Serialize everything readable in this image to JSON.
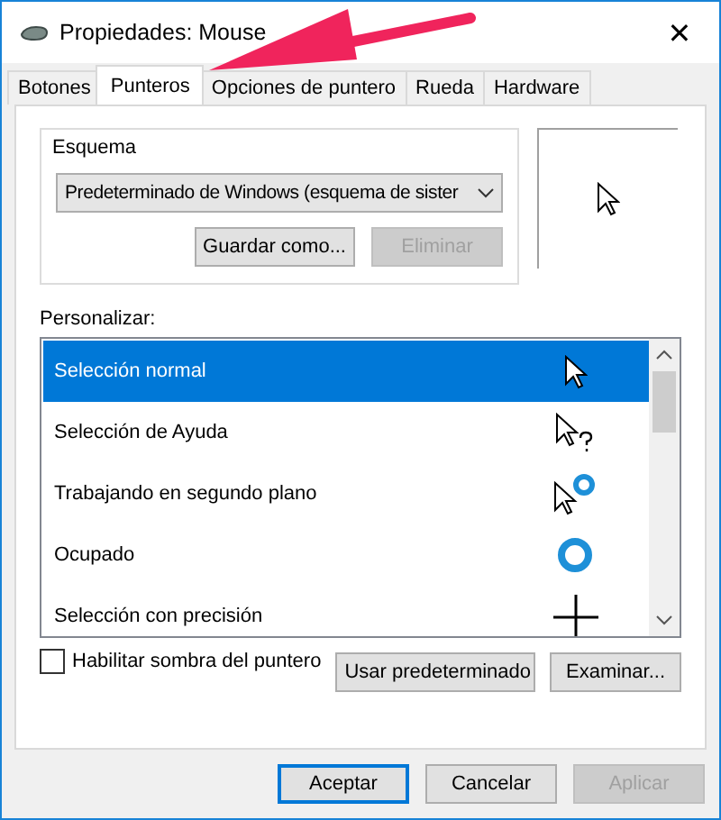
{
  "window": {
    "title": "Propiedades: Mouse",
    "close": "✕"
  },
  "tabs": [
    {
      "label": "Botones",
      "selected": false
    },
    {
      "label": "Punteros",
      "selected": true
    },
    {
      "label": "Opciones de puntero",
      "selected": false
    },
    {
      "label": "Rueda",
      "selected": false
    },
    {
      "label": "Hardware",
      "selected": false
    }
  ],
  "scheme": {
    "label": "Esquema",
    "value": "Predeterminado de Windows (esquema de sister",
    "buttons": [
      {
        "label": "Guardar como...",
        "disabled": false
      },
      {
        "label": "Eliminar",
        "disabled": true
      }
    ]
  },
  "customize": {
    "label": "Personalizar:",
    "items": [
      {
        "label": "Selección normal",
        "kind": "arrow",
        "selected": true
      },
      {
        "label": "Selección de Ayuda",
        "kind": "help",
        "selected": false
      },
      {
        "label": "Trabajando en segundo plano",
        "kind": "working",
        "selected": false
      },
      {
        "label": "Ocupado",
        "kind": "busy",
        "selected": false
      },
      {
        "label": "Selección con precisión",
        "kind": "cross",
        "selected": false
      }
    ]
  },
  "shadow": {
    "label": "Habilitar sombra del puntero",
    "checked": false
  },
  "list_buttons": [
    {
      "label": "Usar predeterminado",
      "disabled": false
    },
    {
      "label": "Examinar...",
      "disabled": false
    }
  ],
  "dialog_buttons": [
    {
      "label": "Aceptar",
      "disabled": false,
      "default": true
    },
    {
      "label": "Cancelar",
      "disabled": false,
      "default": false
    },
    {
      "label": "Aplicar",
      "disabled": true,
      "default": false
    }
  ]
}
